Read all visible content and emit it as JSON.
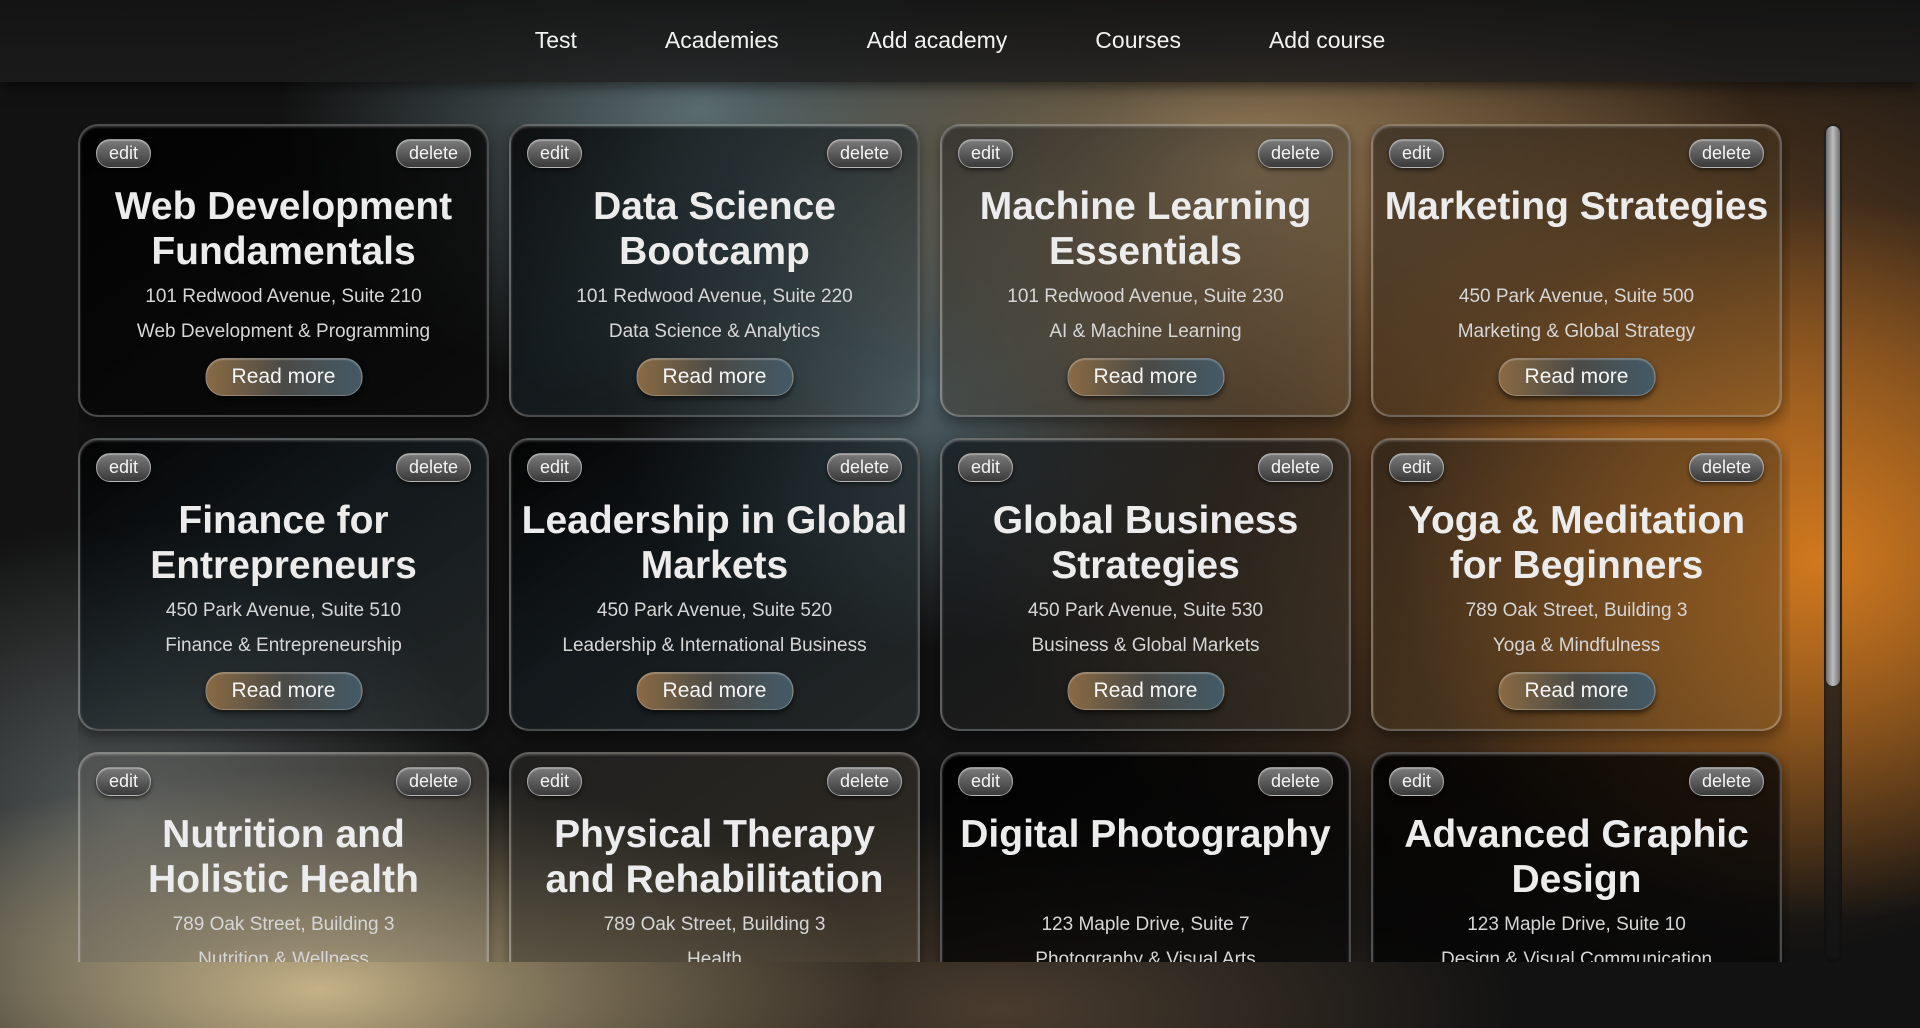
{
  "nav": {
    "items": [
      {
        "label": "Test"
      },
      {
        "label": "Academies"
      },
      {
        "label": "Add academy"
      },
      {
        "label": "Courses"
      },
      {
        "label": "Add course"
      }
    ]
  },
  "card_actions": {
    "edit_label": "edit",
    "delete_label": "delete",
    "read_more_label": "Read more"
  },
  "courses": [
    {
      "title": "Web Development Fundamentals",
      "address": "101 Redwood Avenue, Suite 210",
      "category": "Web Development & Programming"
    },
    {
      "title": "Data Science Bootcamp",
      "address": "101 Redwood Avenue, Suite 220",
      "category": "Data Science & Analytics"
    },
    {
      "title": "Machine Learning Essentials",
      "address": "101 Redwood Avenue, Suite 230",
      "category": "AI & Machine Learning"
    },
    {
      "title": "Marketing Strategies",
      "address": "450 Park Avenue, Suite 500",
      "category": "Marketing & Global Strategy"
    },
    {
      "title": "Finance for Entrepreneurs",
      "address": "450 Park Avenue, Suite 510",
      "category": "Finance & Entrepreneurship"
    },
    {
      "title": "Leadership in Global Markets",
      "address": "450 Park Avenue, Suite 520",
      "category": "Leadership & International Business"
    },
    {
      "title": "Global Business Strategies",
      "address": "450 Park Avenue, Suite 530",
      "category": "Business & Global Markets"
    },
    {
      "title": "Yoga & Meditation for Beginners",
      "address": "789 Oak Street, Building 3",
      "category": "Yoga & Mindfulness"
    },
    {
      "title": "Nutrition and Holistic Health",
      "address": "789 Oak Street, Building 3",
      "category": "Nutrition & Wellness"
    },
    {
      "title": "Physical Therapy and Rehabilitation",
      "address": "789 Oak Street, Building 3",
      "category": "Health"
    },
    {
      "title": "Digital Photography",
      "address": "123 Maple Drive, Suite 7",
      "category": "Photography & Visual Arts"
    },
    {
      "title": "Advanced Graphic Design",
      "address": "123 Maple Drive, Suite 10",
      "category": "Design & Visual Communication"
    }
  ],
  "colors": {
    "accent_orange": "#d67c1e",
    "card_text": "#ececec",
    "nav_text": "#f2f2f2"
  }
}
